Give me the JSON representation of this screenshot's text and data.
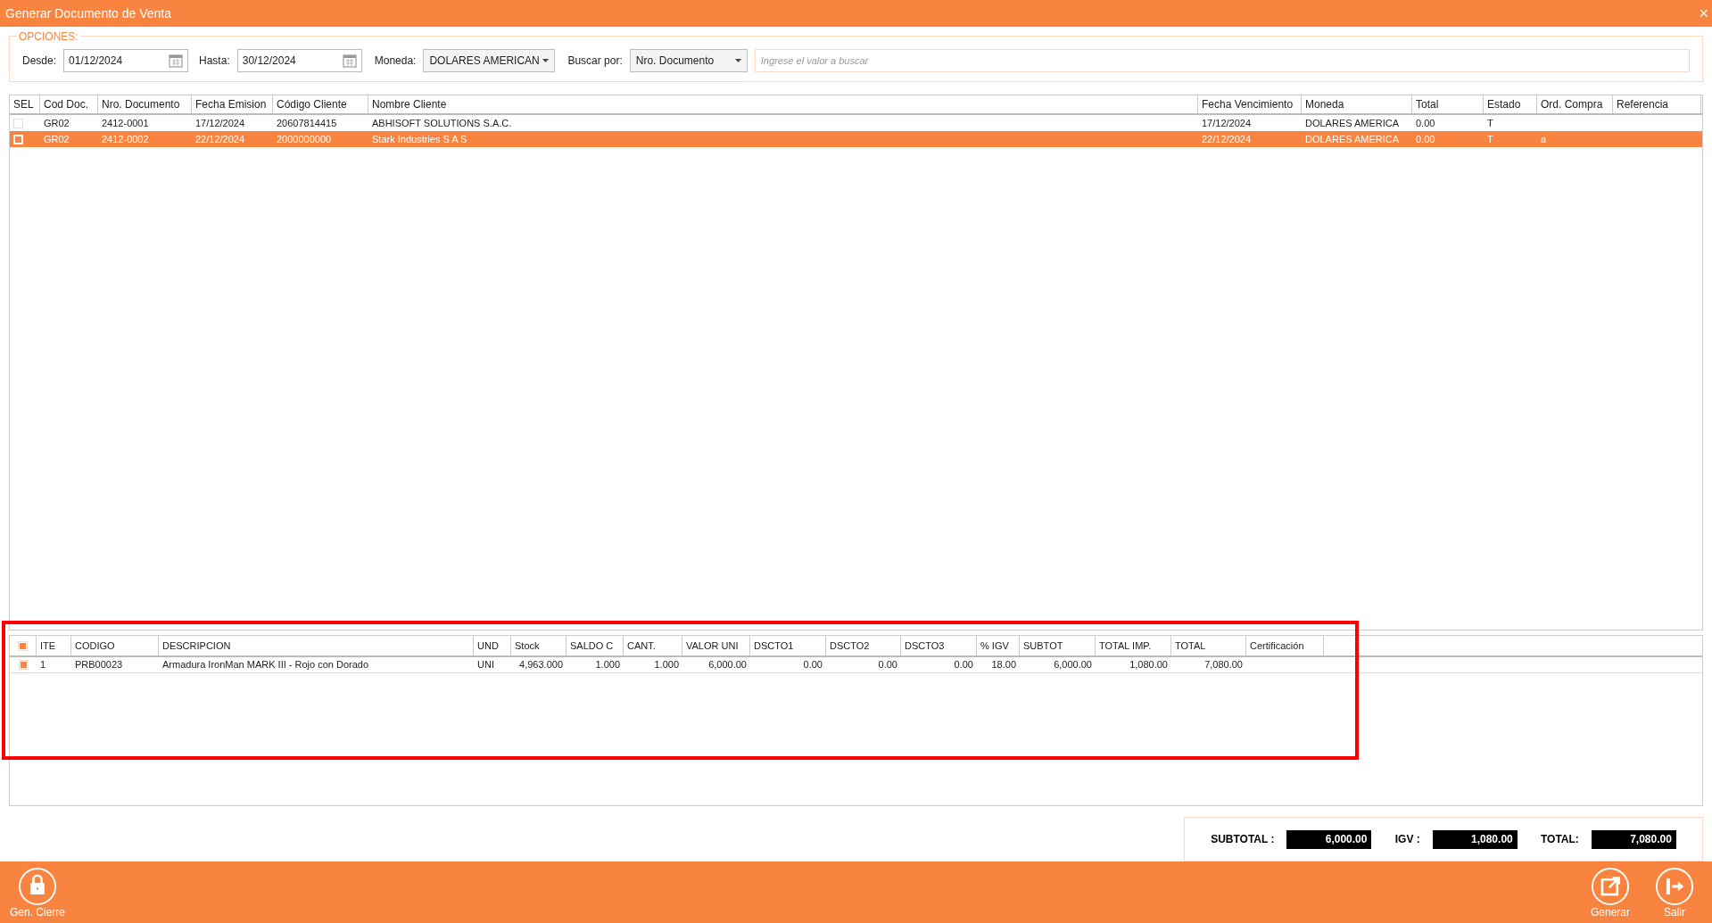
{
  "window": {
    "title": "Generar Documento de Venta",
    "close": "×"
  },
  "options": {
    "legend": "OPCIONES:",
    "desde": {
      "label": "Desde:",
      "value": "01/12/2024"
    },
    "hasta": {
      "label": "Hasta:",
      "value": "30/12/2024"
    },
    "moneda": {
      "label": "Moneda:",
      "value": "DOLARES AMERICAN"
    },
    "buscar_por": {
      "label": "Buscar por:",
      "value": "Nro. Documento"
    },
    "search": {
      "placeholder": "Ingrese el valor a buscar"
    }
  },
  "documents": {
    "columns": [
      "SEL",
      "Cod Doc.",
      "Nro. Documento",
      "Fecha Emision",
      "Código Cliente",
      "Nombre Cliente",
      "Fecha Vencimiento",
      "Moneda",
      "Total",
      "Estado",
      "Ord. Compra",
      "Referencia"
    ],
    "rows": [
      {
        "selected": false,
        "cells": [
          "",
          "GR02",
          "2412-0001",
          "17/12/2024",
          "20607814415",
          "ABHISOFT SOLUTIONS S.A.C.",
          "17/12/2024",
          "DOLARES AMERICA",
          "0.00",
          "T",
          "",
          ""
        ]
      },
      {
        "selected": true,
        "cells": [
          "",
          "GR02",
          "2412-0002",
          "22/12/2024",
          "2000000000",
          "Stark Industries S A S",
          "22/12/2024",
          "DOLARES AMERICA",
          "0.00",
          "T",
          "a",
          ""
        ]
      }
    ]
  },
  "items": {
    "header_checked": true,
    "columns": [
      {
        "kind": "check"
      },
      {
        "label": "ITE",
        "kind": "text"
      },
      {
        "label": "CODIGO",
        "kind": "text"
      },
      {
        "label": "DESCRIPCION",
        "kind": "text"
      },
      {
        "label": "UND",
        "kind": "text"
      },
      {
        "label": "Stock",
        "kind": "number"
      },
      {
        "label": "SALDO C",
        "kind": "number"
      },
      {
        "label": "CANT.",
        "kind": "number"
      },
      {
        "label": "VALOR UNI",
        "kind": "number"
      },
      {
        "label": "DSCTO1",
        "kind": "number"
      },
      {
        "label": "DSCTO2",
        "kind": "number"
      },
      {
        "label": "DSCTO3",
        "kind": "number"
      },
      {
        "label": "% IGV",
        "kind": "number"
      },
      {
        "label": "SUBTOT",
        "kind": "number"
      },
      {
        "label": "TOTAL IMP.",
        "kind": "number"
      },
      {
        "label": "TOTAL",
        "kind": "number"
      },
      {
        "label": "Certificación",
        "kind": "text"
      }
    ],
    "rows": [
      {
        "checked": true,
        "cells": [
          "",
          "1",
          "PRB00023",
          "Armadura IronMan MARK III - Rojo con Dorado",
          "UNI",
          "4,963.000",
          "1.000",
          "1.000",
          "6,000.00",
          "0.00",
          "0.00",
          "0.00",
          "18.00",
          "6,000.00",
          "1,080.00",
          "7,080.00",
          ""
        ]
      }
    ]
  },
  "totals": [
    {
      "label": "SUBTOTAL :",
      "value": "6,000.00"
    },
    {
      "label": "IGV :",
      "value": "1,080.00"
    },
    {
      "label": "TOTAL:",
      "value": "7,080.00"
    }
  ],
  "footer": {
    "left": [
      {
        "label": "Gen. Cierre",
        "kind": "lock"
      }
    ],
    "right": [
      {
        "label": "Generar",
        "kind": "export"
      },
      {
        "label": "Salir",
        "kind": "exit"
      }
    ]
  }
}
